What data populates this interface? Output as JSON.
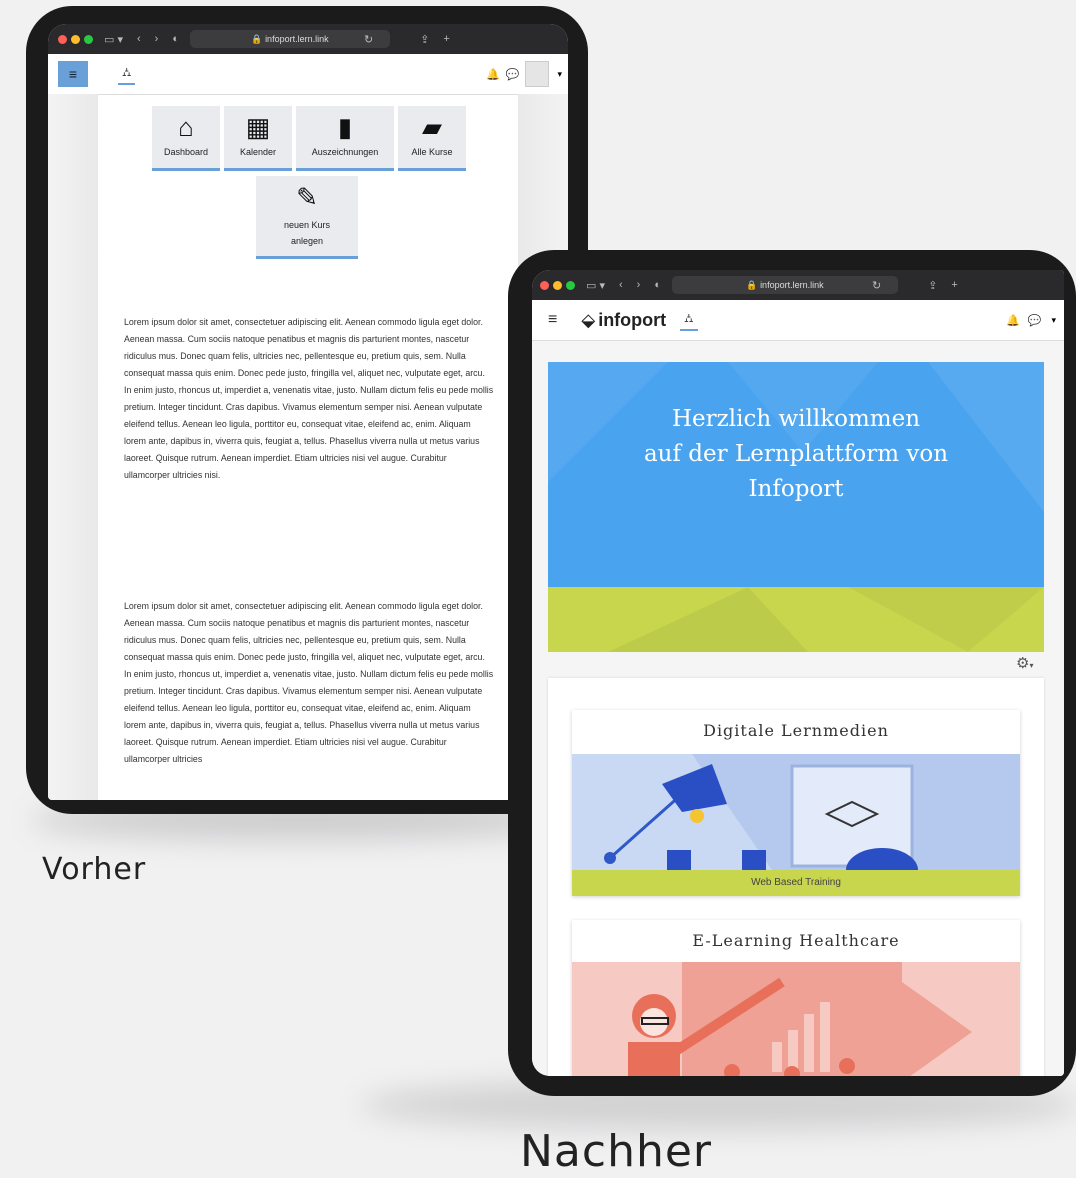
{
  "before": {
    "caption": "Vorher",
    "browser": {
      "url": "infoport.lern.link"
    },
    "tiles": [
      {
        "label": "Dashboard",
        "icon": "home-icon"
      },
      {
        "label": "Kalender",
        "icon": "calendar-icon"
      },
      {
        "label": "Auszeichnungen",
        "icon": "bookmark-icon"
      },
      {
        "label": "Alle Kurse",
        "icon": "book-icon"
      }
    ],
    "new_course_tile": {
      "label": "neuen Kurs anlegen",
      "icon": "edit-icon"
    },
    "paragraph1": "Lorem ipsum dolor sit amet, consectetuer adipiscing elit. Aenean commodo ligula eget dolor. Aenean massa. Cum sociis natoque penatibus et magnis dis parturient montes, nascetur ridiculus mus. Donec quam felis, ultricies nec, pellentesque eu, pretium quis, sem. Nulla consequat massa quis enim. Donec pede justo, fringilla vel, aliquet nec, vulputate eget, arcu. In enim justo, rhoncus ut, imperdiet a, venenatis vitae, justo. Nullam dictum felis eu pede mollis pretium. Integer tincidunt. Cras dapibus. Vivamus elementum semper nisi. Aenean vulputate eleifend tellus. Aenean leo ligula, porttitor eu, consequat vitae, eleifend ac, enim. Aliquam lorem ante, dapibus in, viverra quis, feugiat a, tellus. Phasellus viverra nulla ut metus varius laoreet. Quisque rutrum. Aenean imperdiet. Etiam ultricies nisi vel augue. Curabitur ullamcorper ultricies nisi.",
    "paragraph2": "Lorem ipsum dolor sit amet, consectetuer adipiscing elit. Aenean commodo ligula eget dolor. Aenean massa. Cum sociis natoque penatibus et magnis dis parturient montes, nascetur ridiculus mus. Donec quam felis, ultricies nec, pellentesque eu, pretium quis, sem. Nulla consequat massa quis enim. Donec pede justo, fringilla vel, aliquet nec, vulputate eget, arcu. In enim justo, rhoncus ut, imperdiet a, venenatis vitae, justo. Nullam dictum felis eu pede mollis pretium. Integer tincidunt. Cras dapibus. Vivamus elementum semper nisi. Aenean vulputate eleifend tellus. Aenean leo ligula, porttitor eu, consequat vitae, eleifend ac, enim. Aliquam lorem ante, dapibus in, viverra quis, feugiat a, tellus. Phasellus viverra nulla ut metus varius laoreet. Quisque rutrum. Aenean imperdiet. Etiam ultricies nisi vel augue. Curabitur ullamcorper ultricies"
  },
  "after": {
    "caption": "Nachher",
    "browser": {
      "url": "infoport.lern.link"
    },
    "logo_text": "infoport",
    "hero": {
      "line1": "Herzlich willkommen",
      "line2": "auf der Lernplattform von",
      "line3": "Infoport"
    },
    "cards": [
      {
        "title": "Digitale Lernmedien",
        "tag": "Web Based Training"
      },
      {
        "title": "E-Learning Healthcare"
      }
    ],
    "colors": {
      "hero_blue": "#4aa3ef",
      "hero_green": "#c8d64e",
      "card1_bg": "#c9d8f3",
      "card2_bg": "#f6c9c2",
      "accent": "#e8705b"
    }
  }
}
